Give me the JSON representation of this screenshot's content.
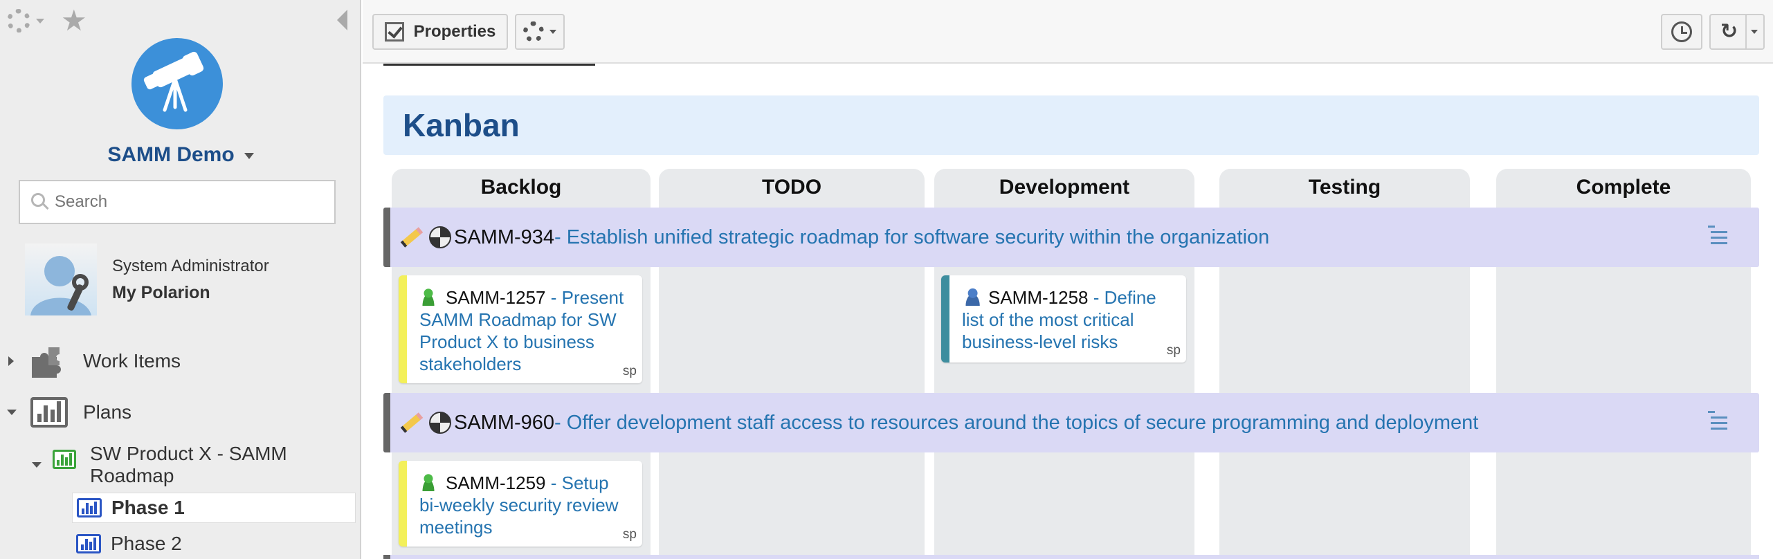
{
  "sidebar": {
    "project_name": "SAMM Demo",
    "search_placeholder": "Search",
    "user": {
      "name": "System Administrator",
      "link": "My Polarion"
    },
    "nav": {
      "work_items": "Work Items",
      "plans": "Plans",
      "plan_name": "SW Product X - SAMM Roadmap",
      "phases": [
        "Phase 1",
        "Phase 2"
      ]
    }
  },
  "toolbar": {
    "properties_label": "Properties"
  },
  "kanban": {
    "title": "Kanban",
    "columns": [
      "Backlog",
      "TODO",
      "Development",
      "Testing",
      "Complete"
    ],
    "swimlanes": [
      {
        "id": "SAMM-934",
        "title": " - Establish unified strategic roadmap for software security within the organization"
      },
      {
        "id": "SAMM-960",
        "title": " - Offer development staff access to resources around the topics of secure programming and deployment"
      }
    ],
    "cards": [
      {
        "id": "SAMM-1257",
        "title": " - Present SAMM Roadmap for SW Product X to business stakeholders",
        "sp": "sp"
      },
      {
        "id": "SAMM-1258",
        "title": " - Define list of the most critical business-level risks",
        "sp": "sp"
      },
      {
        "id": "SAMM-1259",
        "title": " - Setup bi-weekly security review meetings",
        "sp": "sp"
      }
    ]
  },
  "colors": {
    "brand_blue": "#1d4e89",
    "link_blue": "#2574b0",
    "swimlane_bg": "#dad9f5",
    "header_bg": "#e3effc",
    "card_yellow": "#f3f05a",
    "card_teal": "#3d8d9e"
  }
}
